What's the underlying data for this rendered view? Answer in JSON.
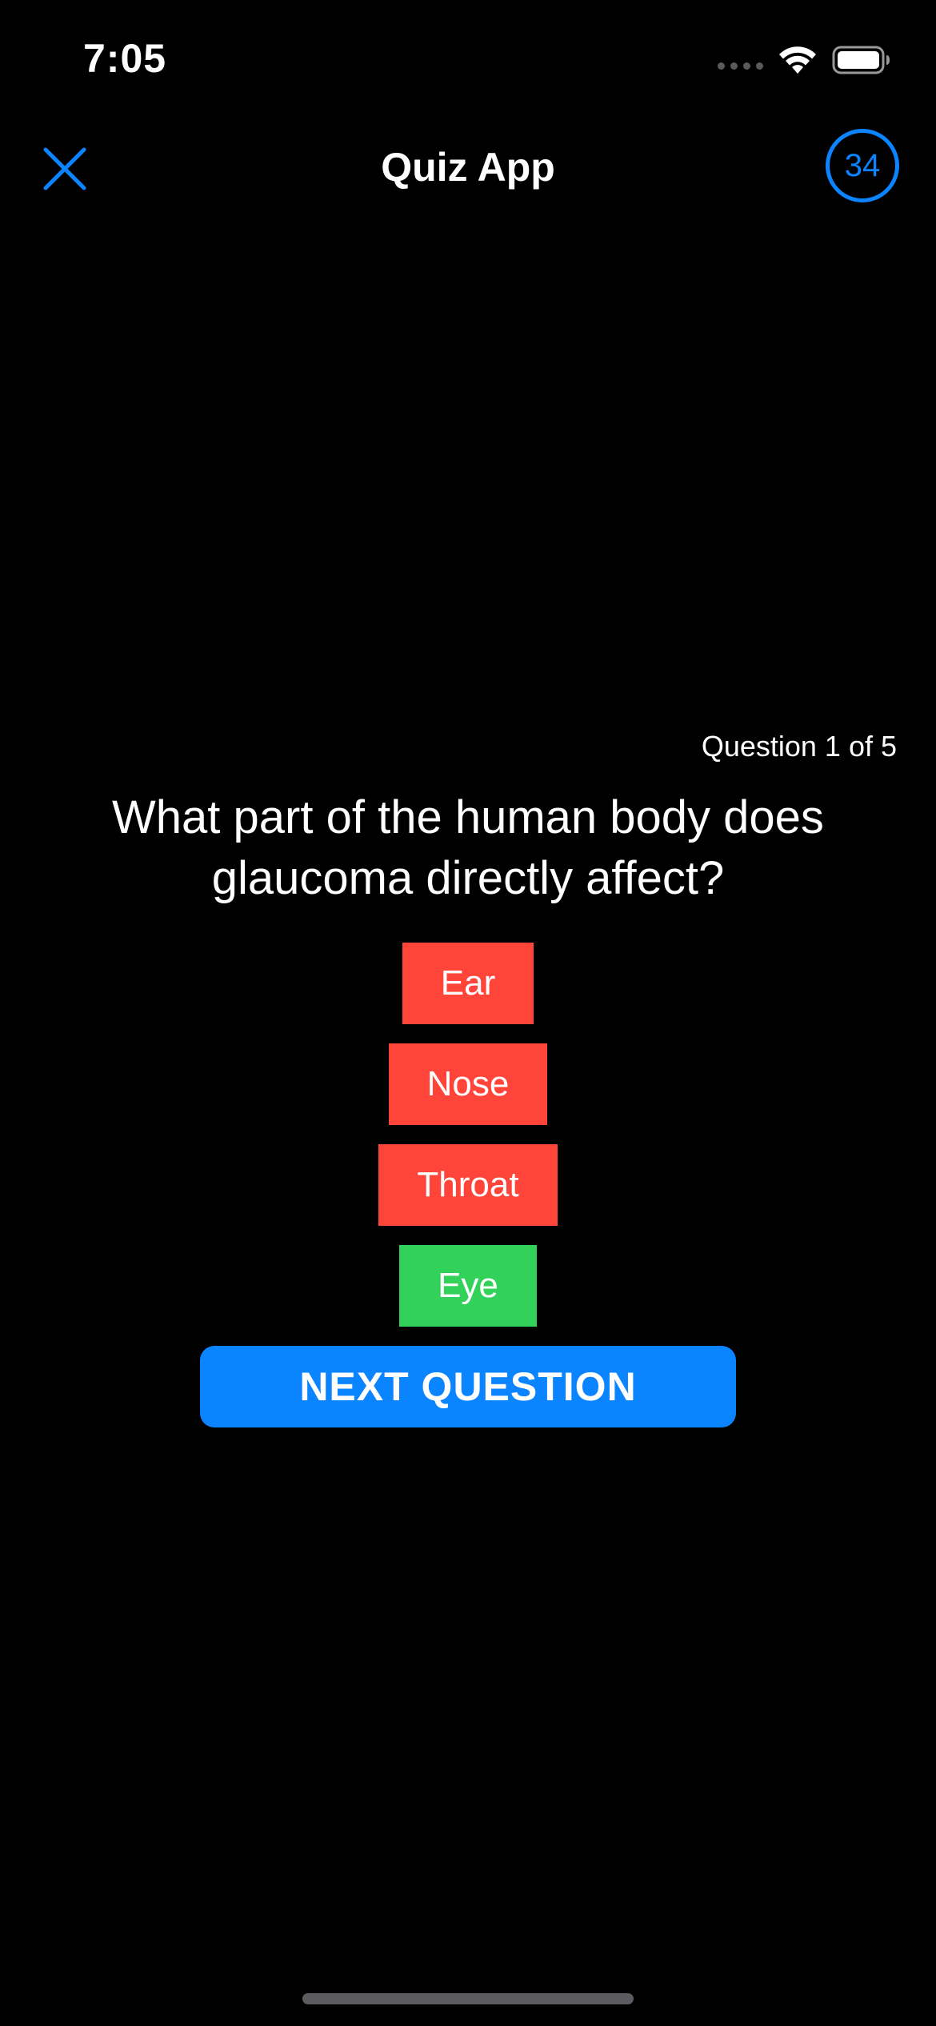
{
  "status_bar": {
    "time": "7:05",
    "icons": [
      "cellular-signal-icon",
      "wifi-icon",
      "battery-icon"
    ]
  },
  "nav": {
    "title": "Quiz App",
    "close_icon": "close-icon",
    "timer": "34"
  },
  "quiz": {
    "counter": "Question 1 of 5",
    "question": "What part of the human body does glaucoma directly affect?",
    "answers": [
      {
        "label": "Ear",
        "state": "wrong"
      },
      {
        "label": "Nose",
        "state": "wrong"
      },
      {
        "label": "Throat",
        "state": "wrong"
      },
      {
        "label": "Eye",
        "state": "correct"
      }
    ],
    "next_label": "NEXT QUESTION"
  },
  "colors": {
    "background": "#000000",
    "accent": "#0a84ff",
    "wrong": "#ff453a",
    "correct": "#32d15a"
  }
}
